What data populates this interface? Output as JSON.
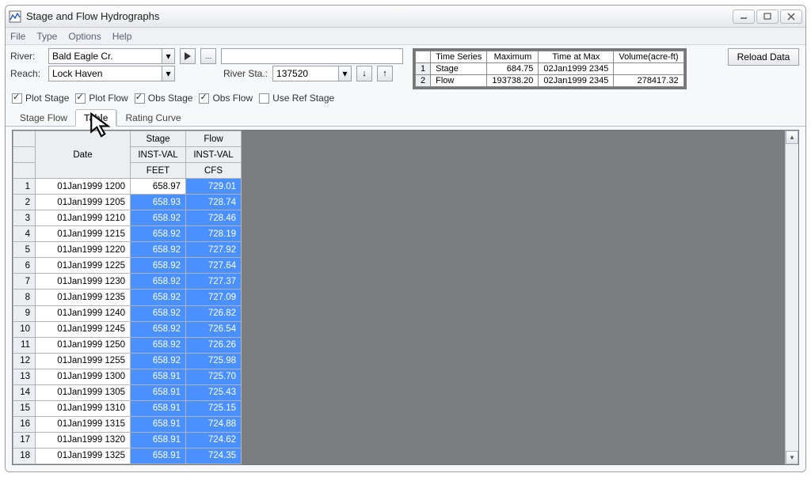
{
  "window": {
    "title": "Stage and Flow Hydrographs"
  },
  "menu": {
    "file": "File",
    "type": "Type",
    "options": "Options",
    "help": "Help"
  },
  "controls": {
    "river_label": "River:",
    "river_value": "Bald Eagle Cr.",
    "reach_label": "Reach:",
    "reach_value": "Lock Haven",
    "riversta_label": "River Sta.:",
    "riversta_value": "137520",
    "reload": "Reload Data"
  },
  "checks": {
    "plot_stage": "Plot Stage",
    "plot_flow": "Plot Flow",
    "obs_stage": "Obs Stage",
    "obs_flow": "Obs Flow",
    "use_ref_stage": "Use Ref Stage"
  },
  "summary": {
    "headers": {
      "ts": "Time Series",
      "max": "Maximum",
      "tmax": "Time at Max",
      "vol": "Volume(acre-ft)"
    },
    "rows": [
      {
        "idx": "1",
        "name": "Stage",
        "max": "684.75",
        "tmax": "02Jan1999  2345",
        "vol": ""
      },
      {
        "idx": "2",
        "name": "Flow",
        "max": "193738.20",
        "tmax": "02Jan1999  2345",
        "vol": "278417.32"
      }
    ]
  },
  "tabs": {
    "stage_flow": "Stage Flow",
    "table": "Table",
    "rating": "Rating Curve"
  },
  "grid": {
    "h1": {
      "date": "Date",
      "stage": "Stage",
      "flow": "Flow"
    },
    "h2": {
      "stage": "INST-VAL",
      "flow": "INST-VAL"
    },
    "h3": {
      "stage": "FEET",
      "flow": "CFS"
    },
    "rows": [
      {
        "i": "1",
        "date": "01Jan1999  1200",
        "stage": "658.97",
        "flow": "729.01"
      },
      {
        "i": "2",
        "date": "01Jan1999  1205",
        "stage": "658.93",
        "flow": "728.74"
      },
      {
        "i": "3",
        "date": "01Jan1999  1210",
        "stage": "658.92",
        "flow": "728.46"
      },
      {
        "i": "4",
        "date": "01Jan1999  1215",
        "stage": "658.92",
        "flow": "728.19"
      },
      {
        "i": "5",
        "date": "01Jan1999  1220",
        "stage": "658.92",
        "flow": "727.92"
      },
      {
        "i": "6",
        "date": "01Jan1999  1225",
        "stage": "658.92",
        "flow": "727.64"
      },
      {
        "i": "7",
        "date": "01Jan1999  1230",
        "stage": "658.92",
        "flow": "727.37"
      },
      {
        "i": "8",
        "date": "01Jan1999  1235",
        "stage": "658.92",
        "flow": "727.09"
      },
      {
        "i": "9",
        "date": "01Jan1999  1240",
        "stage": "658.92",
        "flow": "726.82"
      },
      {
        "i": "10",
        "date": "01Jan1999  1245",
        "stage": "658.92",
        "flow": "726.54"
      },
      {
        "i": "11",
        "date": "01Jan1999  1250",
        "stage": "658.92",
        "flow": "726.26"
      },
      {
        "i": "12",
        "date": "01Jan1999  1255",
        "stage": "658.92",
        "flow": "725.98"
      },
      {
        "i": "13",
        "date": "01Jan1999  1300",
        "stage": "658.91",
        "flow": "725.70"
      },
      {
        "i": "14",
        "date": "01Jan1999  1305",
        "stage": "658.91",
        "flow": "725.43"
      },
      {
        "i": "15",
        "date": "01Jan1999  1310",
        "stage": "658.91",
        "flow": "725.15"
      },
      {
        "i": "16",
        "date": "01Jan1999  1315",
        "stage": "658.91",
        "flow": "724.88"
      },
      {
        "i": "17",
        "date": "01Jan1999  1320",
        "stage": "658.91",
        "flow": "724.62"
      },
      {
        "i": "18",
        "date": "01Jan1999  1325",
        "stage": "658.91",
        "flow": "724.35"
      }
    ]
  }
}
